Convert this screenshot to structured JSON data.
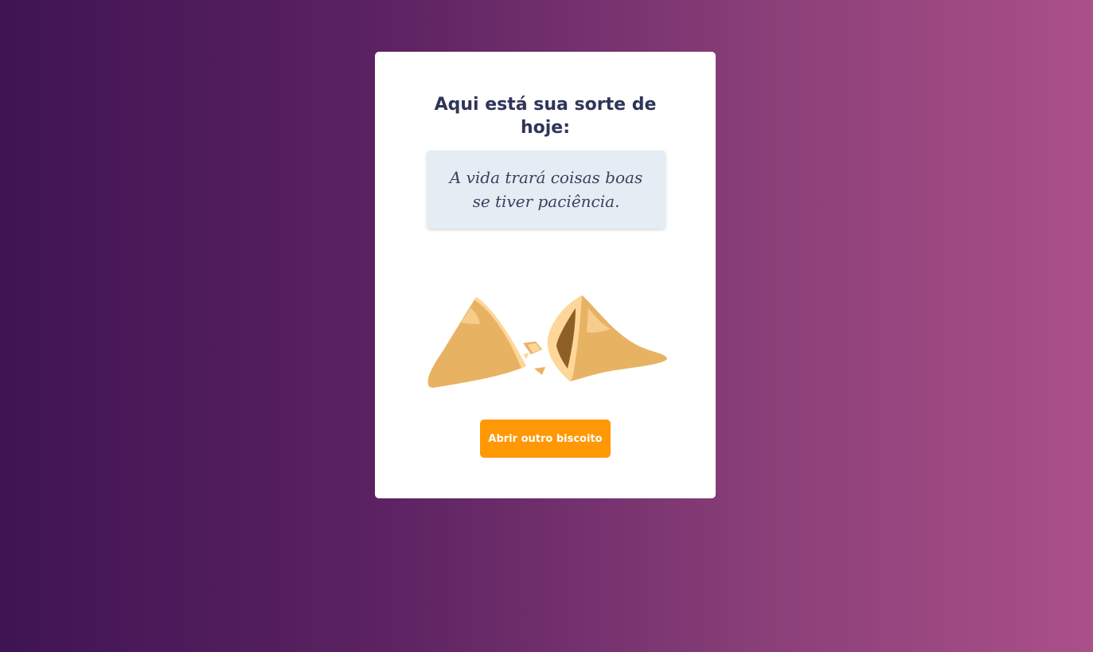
{
  "card": {
    "title": "Aqui está sua sorte de hoje:",
    "fortune": "A vida trará coisas boas se tiver paciência.",
    "illustration": "broken-fortune-cookie-icon",
    "button_label": "Abrir outro biscoito"
  },
  "colors": {
    "background_start": "#3f1453",
    "background_end": "#ab5088",
    "card": "#ffffff",
    "title": "#2f3558",
    "fortune_box": "#e4edf3",
    "button": "#ff9805",
    "cookie": "#e8b263",
    "cookie_light": "#ffd699",
    "cookie_dark": "#8e5f26"
  }
}
